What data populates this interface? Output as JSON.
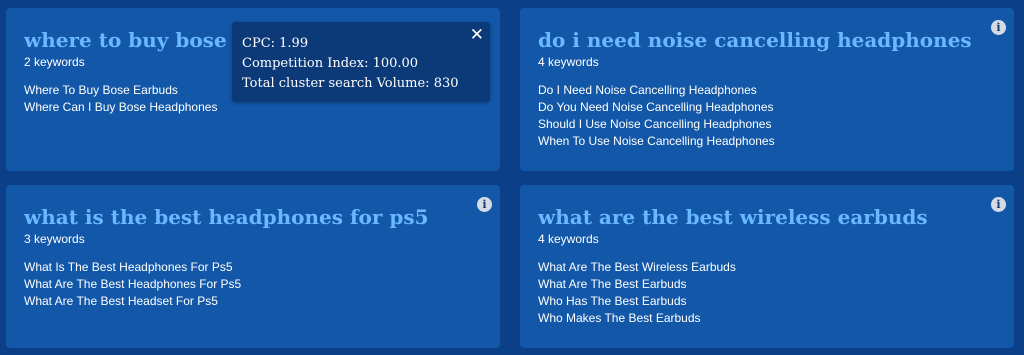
{
  "cards": [
    {
      "title": "where to buy bose earbuds",
      "count": "2 keywords",
      "keywords": [
        "Where To Buy Bose Earbuds",
        "Where Can I Buy Bose Headphones"
      ],
      "info_icon": "info-icon"
    },
    {
      "title": "do i need noise cancelling headphones",
      "count": "4 keywords",
      "keywords": [
        "Do I Need Noise Cancelling Headphones",
        "Do You Need Noise Cancelling Headphones",
        "Should I Use Noise Cancelling Headphones",
        "When To Use Noise Cancelling Headphones"
      ],
      "info_icon": "info-icon"
    },
    {
      "title": "what is the best headphones for ps5",
      "count": "3 keywords",
      "keywords": [
        "What Is The Best Headphones For Ps5",
        "What Are The Best Headphones For Ps5",
        "What Are The Best Headset For Ps5"
      ],
      "info_icon": "info-icon"
    },
    {
      "title": "what are the best wireless earbuds",
      "count": "4 keywords",
      "keywords": [
        "What Are The Best Wireless Earbuds",
        "What Are The Best Earbuds",
        "Who Has The Best Earbuds",
        "Who Makes The Best Earbuds"
      ],
      "info_icon": "info-icon"
    }
  ],
  "tooltip": {
    "cpc": "CPC: 1.99",
    "competition": "Competition Index: 100.00",
    "volume": "Total cluster search Volume: 830",
    "close_label": "✕"
  },
  "colors": {
    "page_bg": "#0b3f88",
    "card_bg": "#1257a8",
    "title": "#6ab8ff",
    "tooltip_bg": "#0c3a78"
  }
}
